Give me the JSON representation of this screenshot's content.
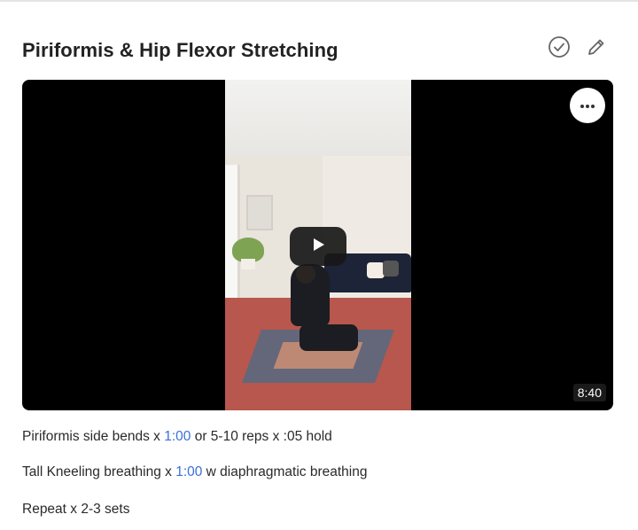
{
  "card": {
    "title": "Piriformis & Hip Flexor Stretching",
    "actions": {
      "complete_icon": "check-circle-icon",
      "edit_icon": "pencil-icon"
    }
  },
  "video": {
    "duration": "8:40",
    "play_icon": "play-icon",
    "more_icon": "more-horizontal-icon"
  },
  "description": {
    "line1": {
      "before": "Piriformis side bends x ",
      "timestamp": "1:00",
      "after": " or 5-10 reps x :05 hold"
    },
    "line2": {
      "before": "Tall Kneeling breathing x ",
      "timestamp": "1:00",
      "after": " w diaphragmatic breathing"
    },
    "line3": {
      "text": "Repeat x 2-3 sets"
    }
  },
  "colors": {
    "link": "#3b6fd9",
    "text": "#2a2a2a",
    "video_bg": "#000000"
  }
}
